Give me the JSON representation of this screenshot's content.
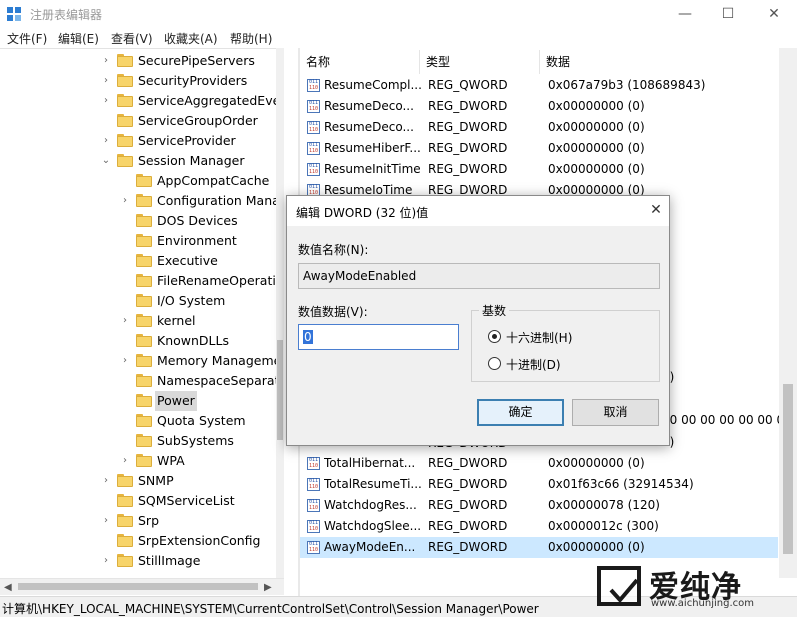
{
  "window": {
    "title": "注册表编辑器",
    "icon": "regedit-icon",
    "controls": {
      "minimize": "—",
      "maximize": "☐",
      "close": "✕"
    }
  },
  "menu": [
    "文件(F)",
    "编辑(E)",
    "查看(V)",
    "收藏夹(A)",
    "帮助(H)"
  ],
  "tree": {
    "items": [
      {
        "label": "SecurePipeServers",
        "expander": "›",
        "level": 1
      },
      {
        "label": "SecurityProviders",
        "expander": "›",
        "level": 1
      },
      {
        "label": "ServiceAggregatedEven",
        "expander": "›",
        "level": 1
      },
      {
        "label": "ServiceGroupOrder",
        "expander": "",
        "level": 1
      },
      {
        "label": "ServiceProvider",
        "expander": "›",
        "level": 1
      },
      {
        "label": "Session Manager",
        "expander": "⌄",
        "level": 1
      },
      {
        "label": "AppCompatCache",
        "expander": "",
        "level": 2
      },
      {
        "label": "Configuration Manag",
        "expander": "›",
        "level": 2
      },
      {
        "label": "DOS Devices",
        "expander": "",
        "level": 2
      },
      {
        "label": "Environment",
        "expander": "",
        "level": 2
      },
      {
        "label": "Executive",
        "expander": "",
        "level": 2
      },
      {
        "label": "FileRenameOperatio",
        "expander": "",
        "level": 2
      },
      {
        "label": "I/O System",
        "expander": "",
        "level": 2
      },
      {
        "label": "kernel",
        "expander": "›",
        "level": 2
      },
      {
        "label": "KnownDLLs",
        "expander": "",
        "level": 2
      },
      {
        "label": "Memory Manageme",
        "expander": "›",
        "level": 2
      },
      {
        "label": "NamespaceSeparatio",
        "expander": "",
        "level": 2
      },
      {
        "label": "Power",
        "expander": "",
        "level": 2,
        "selected": true
      },
      {
        "label": "Quota System",
        "expander": "",
        "level": 2
      },
      {
        "label": "SubSystems",
        "expander": "",
        "level": 2
      },
      {
        "label": "WPA",
        "expander": "›",
        "level": 2
      },
      {
        "label": "SNMP",
        "expander": "›",
        "level": 1
      },
      {
        "label": "SQMServiceList",
        "expander": "",
        "level": 1
      },
      {
        "label": "Srp",
        "expander": "›",
        "level": 1
      },
      {
        "label": "SrpExtensionConfig",
        "expander": "",
        "level": 1
      },
      {
        "label": "StillImage",
        "expander": "›",
        "level": 1
      }
    ]
  },
  "list": {
    "columns": {
      "name": "名称",
      "type": "类型",
      "data": "数据"
    },
    "rows_top": [
      {
        "name": "ResumeCompl...",
        "type": "REG_QWORD",
        "data": "0x067a79b3 (108689843)"
      },
      {
        "name": "ResumeDeco...",
        "type": "REG_DWORD",
        "data": "0x00000000 (0)"
      },
      {
        "name": "ResumeDeco...",
        "type": "REG_DWORD",
        "data": "0x00000000 (0)"
      },
      {
        "name": "ResumeHiberF...",
        "type": "REG_DWORD",
        "data": "0x00000000 (0)"
      },
      {
        "name": "ResumeInitTime",
        "type": "REG_DWORD",
        "data": "0x00000000 (0)"
      },
      {
        "name": "ResumeIoTime",
        "type": "REG_DWORD",
        "data": "0x00000000 (0)"
      }
    ],
    "rows_bottom": [
      {
        "name": "TotalHibernat...",
        "type": "REG_DWORD",
        "data": "0x00000000 (0)"
      },
      {
        "name": "TotalResumeTi...",
        "type": "REG_DWORD",
        "data": "0x01f63c66 (32914534)"
      },
      {
        "name": "WatchdogRes...",
        "type": "REG_DWORD",
        "data": "0x00000078 (120)"
      },
      {
        "name": "WatchdogSlee...",
        "type": "REG_DWORD",
        "data": "0x0000012c (300)"
      },
      {
        "name": "AwayModeEn...",
        "type": "REG_DWORD",
        "data": "0x00000000 (0)",
        "selected": true
      }
    ],
    "partial_behind": {
      "paren": "0)",
      "bytes": "00 00 00 00 00 00 00",
      "row_type": "REG_DWORD",
      "row_data_tail": "7)"
    }
  },
  "statusbar": {
    "path": "计算机\\HKEY_LOCAL_MACHINE\\SYSTEM\\CurrentControlSet\\Control\\Session Manager\\Power"
  },
  "dialog": {
    "title": "编辑 DWORD (32 位)值",
    "close_glyph": "✕",
    "name_label": "数值名称(N):",
    "name_value": "AwayModeEnabled",
    "data_label": "数值数据(V):",
    "data_value": "0",
    "base_label": "基数",
    "radio_hex": "十六进制(H)",
    "radio_dec": "十进制(D)",
    "base_selected": "hex",
    "ok": "确定",
    "cancel": "取消"
  },
  "watermark": {
    "brand": "爱纯净",
    "url": "www.aichunjing.com"
  }
}
